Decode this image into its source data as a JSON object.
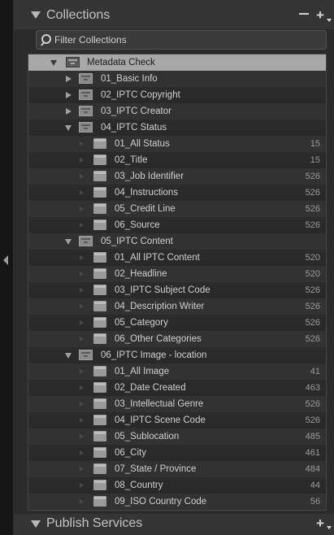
{
  "collections_header": {
    "title": "Collections",
    "minus": "−",
    "plus": "+"
  },
  "filter": {
    "placeholder": "Filter Collections"
  },
  "root": {
    "label": "Metadata Check"
  },
  "sets": [
    {
      "label": "01_Basic Info",
      "expanded": false
    },
    {
      "label": "02_IPTC Copyright",
      "expanded": false
    },
    {
      "label": "03_IPTC Creator",
      "expanded": false
    },
    {
      "label": "04_IPTC Status",
      "expanded": true,
      "items": [
        {
          "label": "01_All Status",
          "count": "15"
        },
        {
          "label": "02_Title",
          "count": "15"
        },
        {
          "label": "03_Job Identifier",
          "count": "526"
        },
        {
          "label": "04_Instructions",
          "count": "526"
        },
        {
          "label": "05_Credit Line",
          "count": "526"
        },
        {
          "label": "06_Source",
          "count": "526"
        }
      ]
    },
    {
      "label": "05_IPTC Content",
      "expanded": true,
      "items": [
        {
          "label": "01_All IPTC Content",
          "count": "520"
        },
        {
          "label": "02_Headline",
          "count": "520"
        },
        {
          "label": "03_IPTC Subject Code",
          "count": "526"
        },
        {
          "label": "04_Description Writer",
          "count": "526"
        },
        {
          "label": "05_Category",
          "count": "526"
        },
        {
          "label": "06_Other Categories",
          "count": "526"
        }
      ]
    },
    {
      "label": "06_IPTC Image - location",
      "expanded": true,
      "items": [
        {
          "label": "01_All Image",
          "count": "41"
        },
        {
          "label": "02_Date Created",
          "count": "463"
        },
        {
          "label": "03_Intellectual Genre",
          "count": "526"
        },
        {
          "label": "04_IPTC Scene Code",
          "count": "526"
        },
        {
          "label": "05_Sublocation",
          "count": "485"
        },
        {
          "label": "06_City",
          "count": "461"
        },
        {
          "label": "07_State / Province",
          "count": "484"
        },
        {
          "label": "08_Country",
          "count": "44"
        },
        {
          "label": "09_ISO Country Code",
          "count": "56"
        }
      ]
    }
  ],
  "publish_header": {
    "title": "Publish Services",
    "plus": "+"
  }
}
